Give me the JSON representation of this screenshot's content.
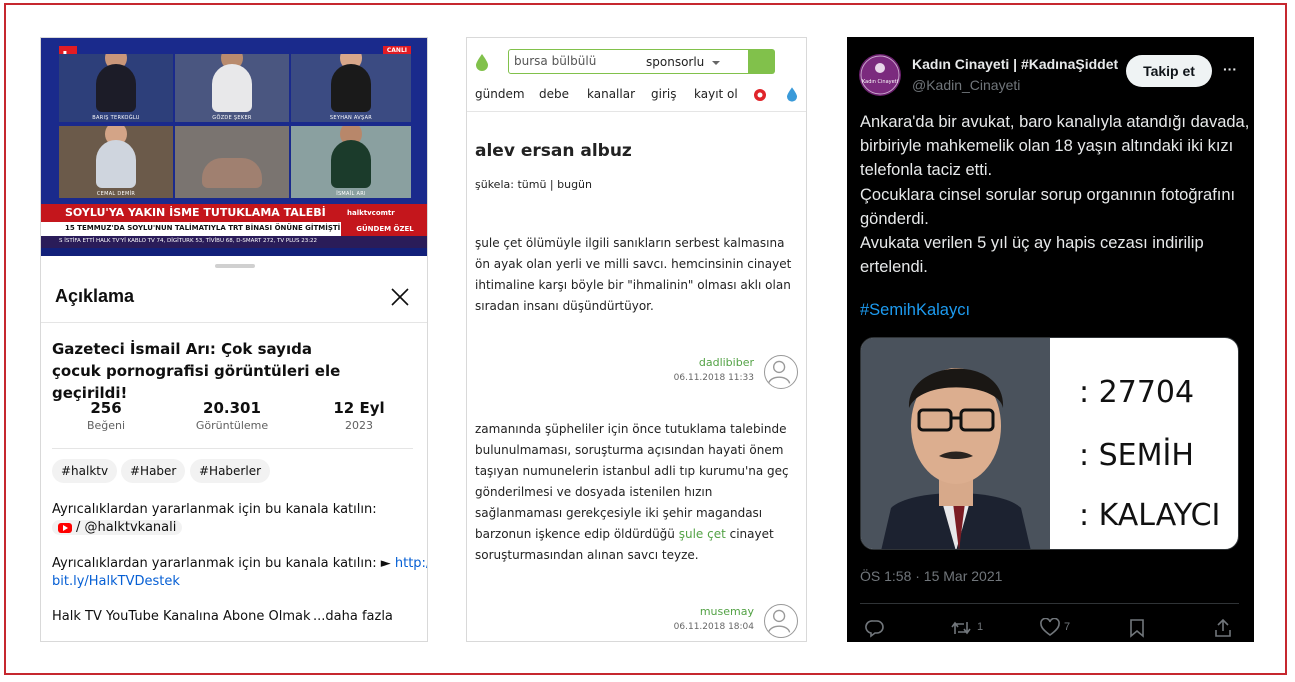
{
  "left": {
    "tv": {
      "logo": "h",
      "live_badge": "CANLI",
      "names": [
        "BARIŞ TERKOĞLU",
        "GÖZDE ŞEKER",
        "SEYHAN AVŞAR",
        "CEMAL DEMİR",
        "İSMAİL ARI"
      ],
      "banner": "SOYLU'YA YAKIN İSME TUTUKLAMA TALEBİ",
      "banner_brand": "halktvcomtr",
      "sub": "15 TEMMUZ'DA SOYLU'NUN TALİMATIYLA TRT BİNASI ÖNÜNE GİTMİŞTİ",
      "gundem": "GÜNDEM ÖZEL",
      "ticker": "S İSTİFA ETTİ  HALK TV'Yİ KABLO TV 74, DİGİTURK 53, TİVİBU 68, D-SMART 272, TV PLUS  23:22"
    },
    "sheet": {
      "title": "Açıklama",
      "video_title": "Gazeteci İsmail Arı: Çok sayıda çocuk pornografisi görüntüleri ele geçirildi!",
      "stats": [
        {
          "value": "256",
          "label": "Beğeni"
        },
        {
          "value": "20.301",
          "label": "Görüntüleme"
        },
        {
          "value": "12 Eyl",
          "label": "2023"
        }
      ],
      "tags": [
        "#halktv",
        "#Haber",
        "#Haberler"
      ],
      "desc1": "Ayrıcalıklardan yararlanmak için bu kanala katılın:",
      "desc1_chip": "/ @halktvkanali",
      "desc2_prefix": "Ayrıcalıklardan yararlanmak için bu kanala katılın: ►",
      "desc2_link_1": "http://",
      "desc2_link_2": "bit.ly/HalkTVDestek",
      "desc3": "Halk TV YouTube Kanalına Abone Olmak İç",
      "more": "...daha fazla"
    }
  },
  "middle": {
    "search_value": "bursa bülbülü",
    "search_scope": "sponsorlu",
    "nav": [
      "gündem",
      "debe",
      "kanallar",
      "giriş",
      "kayıt ol"
    ],
    "title": "alev ersan albuz",
    "sukela": "şükela:  tümü | bugün",
    "entries": [
      {
        "text": "şule çet ölümüyle ilgili sanıkların serbest kalmasına ön ayak olan yerli ve milli savcı. hemcinsinin cinayet ihtimaline karşı böyle bir \"ihmalinin\" olması aklı olan sıradan insanı düşündürtüyor.",
        "author": "dadlibiber",
        "date": "06.11.2018 11:33"
      },
      {
        "text_before": "zamanında şüpheliler için önce tutuklama talebinde bulunulmaması, soruşturma açısından hayati önem taşıyan numunelerin istanbul adli tıp kurumu'na geç gönderilmesi ve dosyada istenilen hızın sağlanmaması gerekçesiyle iki şehir magandası barzonun işkence edip öldürdüğü ",
        "link": "şule çet",
        "text_after": " cinayet soruşturmasından alınan savcı teyze.",
        "author": "musemay",
        "date": "06.11.2018 18:04"
      }
    ]
  },
  "right": {
    "name": "Kadın Cinayeti | #KadınaŞiddet",
    "avatar_text": "Kadın Cinayeti",
    "handle": "@Kadin_Cinayeti",
    "follow": "Takip et",
    "text": "Ankara'da bir avukat, baro kanalıyla atandığı davada, birbiriyle mahkemelik olan 18 yaşın altındaki iki kızı telefonla taciz etti.\nÇocuklara cinsel sorular sorup organının fotoğrafını gönderdi.\nAvukata verilen 5 yıl üç ay hapis cezası indirilip ertelendi.",
    "hashtag": "#SemihKalaycı",
    "media_lines": [
      ": 27704",
      ": SEMİH",
      ": KALAYCI"
    ],
    "time": "ÖS 1:58 · 15 Mar 2021",
    "retweets": "1",
    "likes": "7"
  }
}
